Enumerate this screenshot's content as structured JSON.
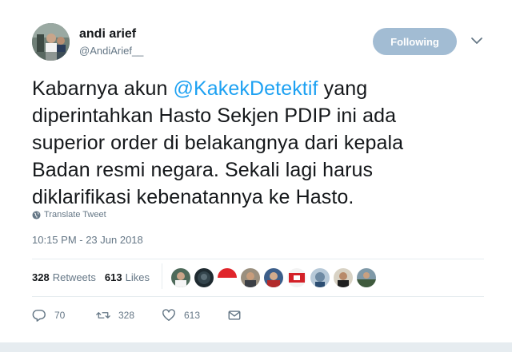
{
  "author": {
    "display_name": "andi arief",
    "handle": "@AndiArief__",
    "avatar_icon": "avatar"
  },
  "follow_button": {
    "label": "Following"
  },
  "tweet": {
    "text_before": "Kabarnya akun ",
    "mention": "@KakekDetektif",
    "text_after": " yang diperintahkan Hasto Sekjen PDIP ini ada superior order di belakangnya dari kepala Badan resmi  negara. Sekali lagi harus diklarifikasi kebenatannya ke Hasto."
  },
  "translate_label": "Translate Tweet",
  "timestamp": "10:15 PM - 23 Jun 2018",
  "stats": {
    "retweets_count": "328",
    "retweets_label": "Retweets",
    "likes_count": "613",
    "likes_label": "Likes"
  },
  "actions": {
    "reply_count": "70",
    "retweet_count": "328",
    "like_count": "613"
  },
  "colors": {
    "accent": "#1da1f2",
    "following_button": "#a2bcd3",
    "muted_text": "#657786"
  }
}
